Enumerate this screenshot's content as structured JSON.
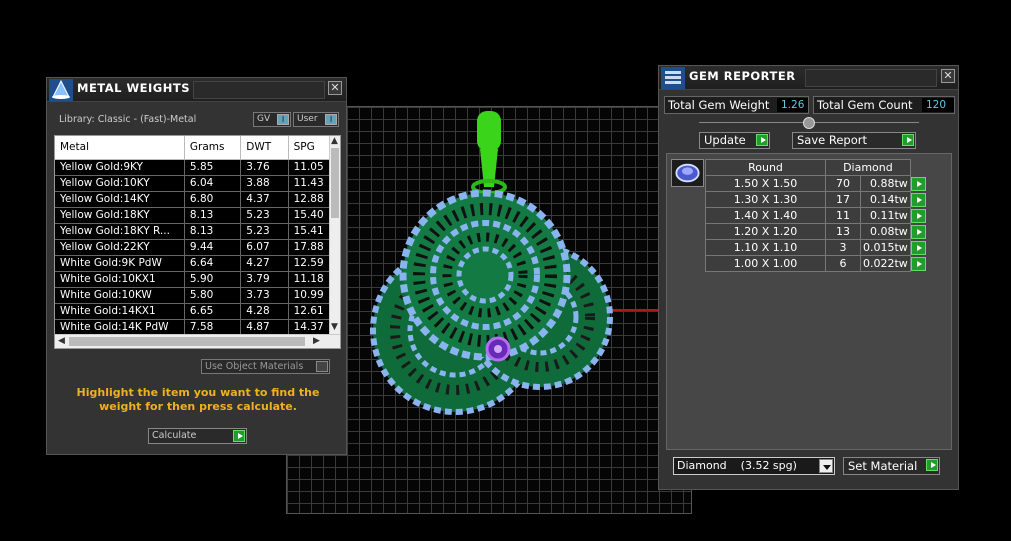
{
  "metal_weights": {
    "title": "METAL WEIGHTS",
    "library": "Library: Classic - (Fast)-Metal",
    "gv_label": "GV",
    "user_label": "User",
    "columns": [
      "Metal",
      "Grams",
      "DWT",
      "SPG"
    ],
    "rows": [
      [
        "Yellow Gold:9KY",
        "5.85",
        "3.76",
        "11.05"
      ],
      [
        "Yellow Gold:10KY",
        "6.04",
        "3.88",
        "11.43"
      ],
      [
        "Yellow Gold:14KY",
        "6.80",
        "4.37",
        "12.88"
      ],
      [
        "Yellow Gold:18KY",
        "8.13",
        "5.23",
        "15.40"
      ],
      [
        "Yellow Gold:18KY R...",
        "8.13",
        "5.23",
        "15.41"
      ],
      [
        "Yellow Gold:22KY",
        "9.44",
        "6.07",
        "17.88"
      ],
      [
        "White Gold:9K PdW",
        "6.64",
        "4.27",
        "12.59"
      ],
      [
        "White Gold:10KX1",
        "5.90",
        "3.79",
        "11.18"
      ],
      [
        "White Gold:10KW",
        "5.80",
        "3.73",
        "10.99"
      ],
      [
        "White Gold:14KX1",
        "6.65",
        "4.28",
        "12.61"
      ],
      [
        "White Gold:14K PdW",
        "7.58",
        "4.87",
        "14.37"
      ]
    ],
    "use_object_materials": "Use Object Materials",
    "hint": "Highlight the item you want to find the weight for then press calculate.",
    "calculate_label": "Calculate"
  },
  "gem_reporter": {
    "title": "GEM REPORTER",
    "total_weight_label": "Total Gem Weight",
    "total_weight_value": "1.26",
    "total_count_label": "Total Gem Count",
    "total_count_value": "120",
    "update_label": "Update",
    "save_report_label": "Save Report",
    "shape_header": "Round",
    "material_header": "Diamond",
    "gems": [
      {
        "size": "1.50 X 1.50",
        "count": "70",
        "weight": "0.88tw"
      },
      {
        "size": "1.30 X 1.30",
        "count": "17",
        "weight": "0.14tw"
      },
      {
        "size": "1.40 X 1.40",
        "count": "11",
        "weight": "0.11tw"
      },
      {
        "size": "1.20 X 1.20",
        "count": "13",
        "weight": "0.08tw"
      },
      {
        "size": "1.10 X 1.10",
        "count": "3",
        "weight": "0.015tw"
      },
      {
        "size": "1.00 X 1.00",
        "count": "6",
        "weight": "0.022tw"
      }
    ],
    "material_select": "Diamond    (3.52 spg)",
    "set_material_label": "Set Material"
  },
  "icons": [
    "metal-weights-icon",
    "gem-reporter-icon",
    "close-icon",
    "gem-thumbnail-icon",
    "green-arrow-icon"
  ],
  "colors": {
    "gem_green": "#1a8a4a",
    "stone_blue": "#8ab4f0",
    "bail_green": "#3ad41a",
    "accent_amber": "#f0b020"
  }
}
